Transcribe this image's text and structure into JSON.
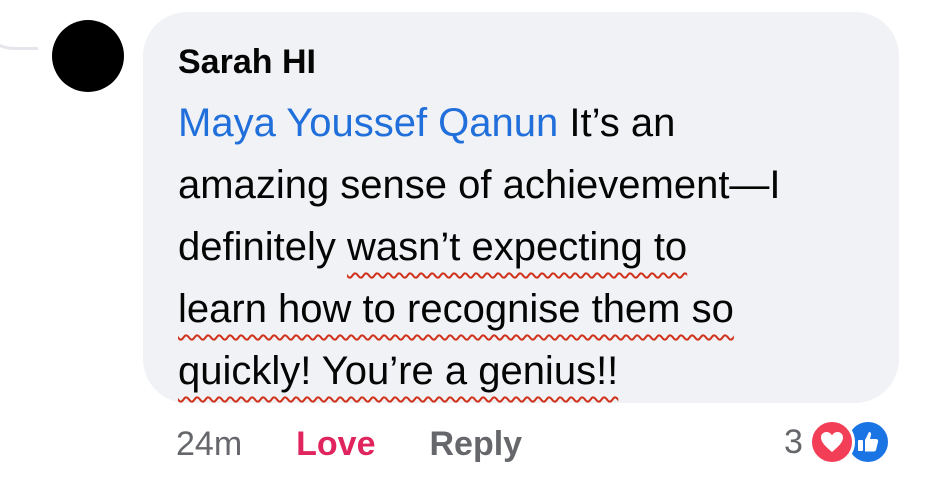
{
  "comment": {
    "author": "Sarah HI",
    "mention": "Maya Youssef Qanun",
    "lines": [
      " It’s an",
      "amazing sense of achievement—I",
      "definitely ",
      "wasn’t expecting to",
      "learn how to recognise them so",
      "quickly! You’re a genius!!"
    ],
    "timestamp": "24m",
    "love_label": "Love",
    "reply_label": "Reply",
    "reaction_count": "3",
    "reactions": [
      "heart-icon",
      "like-icon"
    ]
  },
  "colors": {
    "bubble": "#f0f2f5",
    "mention": "#216fdb",
    "love": "#e0245e",
    "muted": "#65676b",
    "underline": "#d0321c",
    "heart": "#f33e58",
    "like": "#1b74e4"
  }
}
